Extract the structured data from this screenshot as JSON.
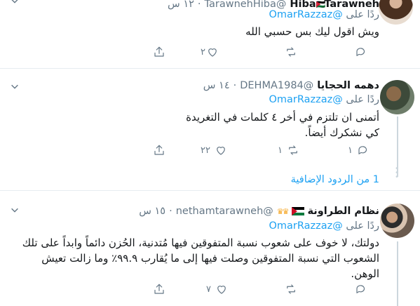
{
  "tweets": [
    {
      "display_name_left": "Hiba",
      "display_name_right": "Tarawneh",
      "handle": "@TarawnehHiba",
      "time": "١٢ س",
      "reply_prefix": "ردًا على",
      "reply_to": "@OmarRazzaz",
      "text": "ويش اقول ليك بس حسبي الله",
      "actions": {
        "reply_count": "",
        "retweet_count": "",
        "like_count": "٢"
      }
    },
    {
      "display_name": "دهمه الحجايا",
      "handle": "@DEHMA1984",
      "time": "١٤ س",
      "reply_prefix": "ردًا على",
      "reply_to": "@OmarRazzaz",
      "text_line1": "أتمنى ان تلتزم في أخر ٤ كلمات في التغريدة",
      "text_line2": "كي نشكرك أيضاً.",
      "actions": {
        "reply_count": "١",
        "retweet_count": "١",
        "like_count": "٢٢"
      },
      "more_replies": "1 من الردود الإضافية"
    },
    {
      "display_name": "نظام الطراونة",
      "handle": "@nethamtarawneh",
      "time": "١٥ س",
      "reply_prefix": "ردًا على",
      "reply_to": "@OmarRazzaz",
      "text_line1": "دولتك، لا خوف على شعوب نسبة المتفوقين فيها مُتدنية، الحُزن دائماً وابداً على تلك",
      "text_line2": "الشعوب التي نسبة المتفوقين وصلت فيها إلى ما يُقارب ٩٩.٩٪ وما زالت تعيش",
      "text_line3": "الوهن.",
      "actions": {
        "reply_count": "",
        "retweet_count": "",
        "like_count": "٧"
      }
    }
  ],
  "icons": [
    "caret-down-icon",
    "reply-icon",
    "retweet-icon",
    "like-icon",
    "share-icon",
    "flag-jordan-icon",
    "crown-icon"
  ],
  "colors": {
    "link": "#1da1f2",
    "muted": "#657786",
    "border": "#e6ecf0"
  }
}
